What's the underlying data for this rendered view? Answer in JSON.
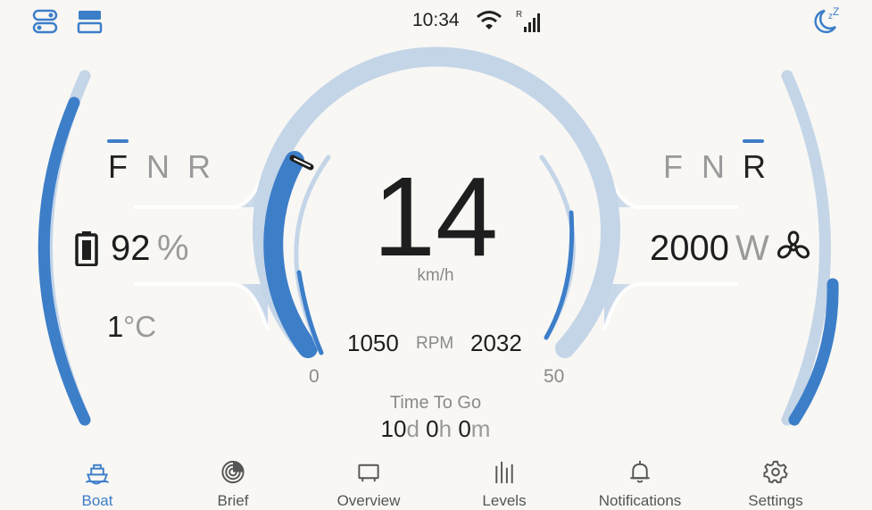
{
  "status": {
    "time": "10:34",
    "roaming": "R"
  },
  "left": {
    "gears": [
      "F",
      "N",
      "R"
    ],
    "battery_value": "92",
    "battery_unit": "%",
    "temp_value": "1",
    "temp_unit": "°C"
  },
  "right": {
    "gears": [
      "F",
      "N",
      "R"
    ],
    "power_value": "2000",
    "power_unit": "W"
  },
  "center": {
    "speed": "14",
    "speed_unit": "km/h",
    "rpm_left": "1050",
    "rpm_label": "RPM",
    "rpm_right": "2032",
    "scale_min": "0",
    "scale_max": "50"
  },
  "time_to_go": {
    "label": "Time To Go",
    "days": "10",
    "days_unit": "d",
    "hours": "0",
    "hours_unit": "h",
    "minutes": "0",
    "minutes_unit": "m"
  },
  "nav": {
    "items": [
      {
        "label": "Boat",
        "icon": "boat-icon",
        "active": true
      },
      {
        "label": "Brief",
        "icon": "brief-icon"
      },
      {
        "label": "Overview",
        "icon": "overview-icon"
      },
      {
        "label": "Levels",
        "icon": "levels-icon"
      },
      {
        "label": "Notifications",
        "icon": "bell-icon"
      },
      {
        "label": "Settings",
        "icon": "gear-icon"
      }
    ]
  },
  "colors": {
    "accent": "#3d7ec9",
    "track": "#c4d5e8",
    "background": "#f8f7f4"
  }
}
